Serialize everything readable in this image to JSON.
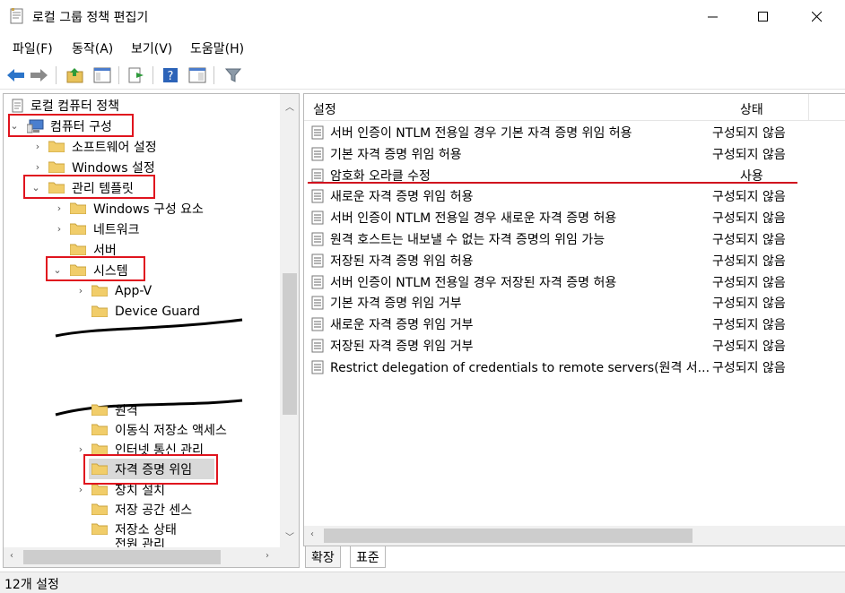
{
  "window": {
    "title": "로컬 그룹 정책 편집기"
  },
  "menu": [
    {
      "label": "파일(F)"
    },
    {
      "label": "동작(A)"
    },
    {
      "label": "보기(V)"
    },
    {
      "label": "도움말(H)"
    }
  ],
  "tree": {
    "root": "로컬 컴퓨터 정책",
    "computer_config": "컴퓨터 구성",
    "software_settings": "소프트웨어 설정",
    "windows_settings": "Windows 설정",
    "admin_templates": "관리 템플릿",
    "windows_components": "Windows 구성 요소",
    "network": "네트워크",
    "server": "서버",
    "system": "시스템",
    "app_v": "App-V",
    "device_guard": "Device Guard",
    "remote_partial": "원격",
    "removable_storage": "이동식 저장소 액세스",
    "internet_comm": "인터넷 통신 관리",
    "credentials_delegation": "자격 증명 위임",
    "device_install": "장치 설치",
    "storage_sense": "저장 공간 센스",
    "storage_health": "저장소 상태",
    "power_partial": "전원 관리"
  },
  "list": {
    "col_setting": "설정",
    "col_state": "상태",
    "rows": [
      {
        "name": "서버 인증이 NTLM 전용일 경우 기본 자격 증명 위임 허용",
        "state": "구성되지 않음"
      },
      {
        "name": "기본 자격 증명 위임 허용",
        "state": "구성되지 않음"
      },
      {
        "name": "암호화 오라클 수정",
        "state": "사용"
      },
      {
        "name": "새로운 자격 증명 위임 허용",
        "state": "구성되지 않음"
      },
      {
        "name": "서버 인증이 NTLM 전용일 경우 새로운 자격 증명 허용",
        "state": "구성되지 않음"
      },
      {
        "name": "원격 호스트는 내보낼 수 없는 자격 증명의 위임 가능",
        "state": "구성되지 않음"
      },
      {
        "name": "저장된 자격 증명 위임 허용",
        "state": "구성되지 않음"
      },
      {
        "name": "서버 인증이 NTLM 전용일 경우 저장된 자격 증명 허용",
        "state": "구성되지 않음"
      },
      {
        "name": "기본 자격 증명 위임 거부",
        "state": "구성되지 않음"
      },
      {
        "name": "새로운 자격 증명 위임 거부",
        "state": "구성되지 않음"
      },
      {
        "name": "저장된 자격 증명 위임 거부",
        "state": "구성되지 않음"
      },
      {
        "name": "Restrict delegation of credentials to remote servers(원격 서...",
        "state": "구성되지 않음"
      }
    ]
  },
  "tabs": {
    "extended": "확장",
    "standard": "표준"
  },
  "status": "12개 설정"
}
